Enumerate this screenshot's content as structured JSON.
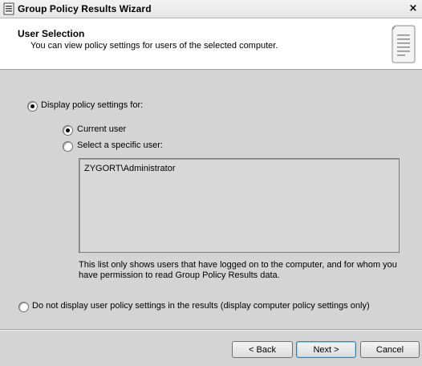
{
  "window": {
    "title": "Group Policy Results Wizard",
    "close_glyph": "×"
  },
  "header": {
    "title": "User Selection",
    "subtitle": "You can view policy settings for users of the selected computer."
  },
  "options": {
    "display_policy": {
      "label": "Display policy settings for:",
      "checked": true
    },
    "current_user": {
      "label": "Current user",
      "checked": true
    },
    "specific_user": {
      "label": "Select a specific user:",
      "checked": false
    },
    "users": [
      "ZYGORT\\Administrator"
    ],
    "note": "This list only shows users that have logged on to the computer, and for whom you have permission to read Group Policy Results data.",
    "no_user_policy": {
      "label": "Do not display user policy settings in the results (display computer policy settings only)",
      "checked": false
    }
  },
  "buttons": {
    "back": "< Back",
    "next": "Next >",
    "cancel": "Cancel"
  },
  "icons": {
    "title": "policy-wizard-icon",
    "header": "document-scroll-icon"
  }
}
